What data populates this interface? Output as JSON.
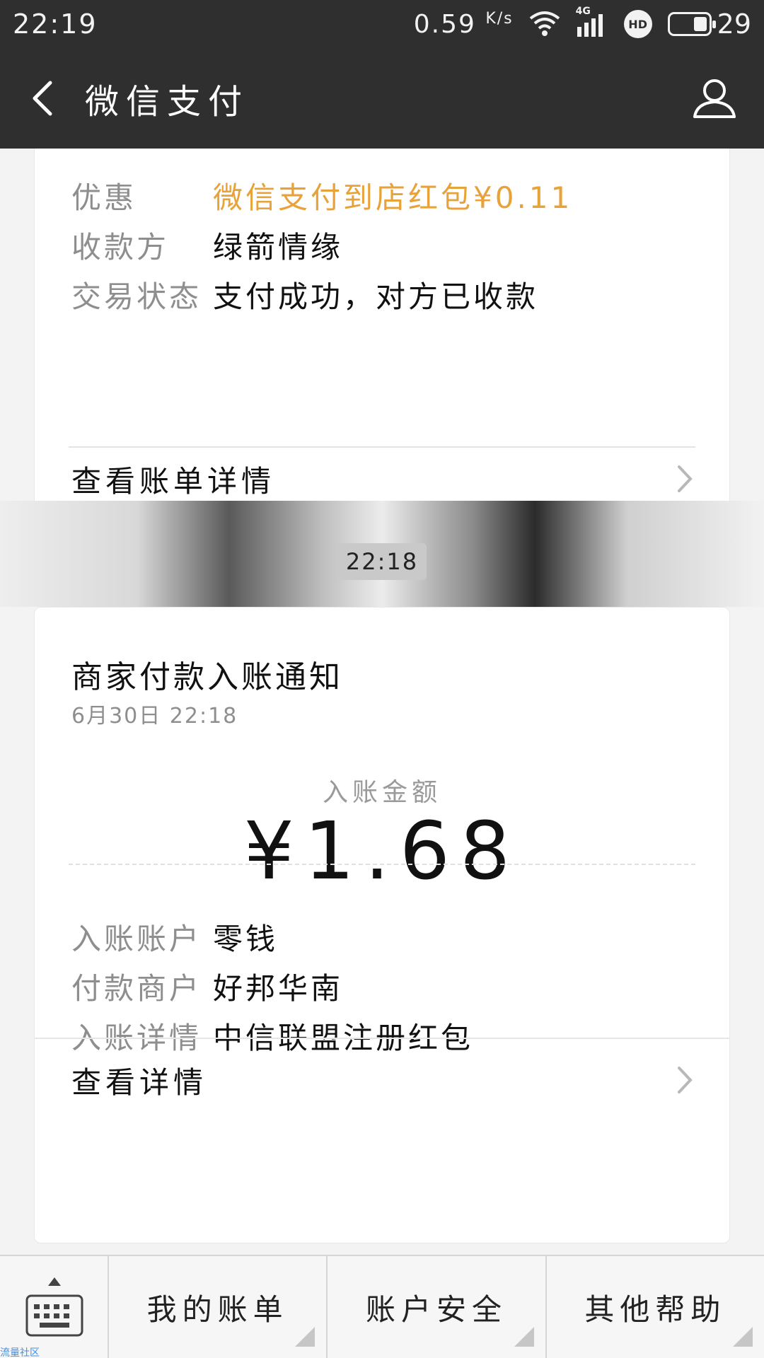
{
  "status_bar": {
    "time": "22:19",
    "speed": "0.59",
    "speed_unit": "K/s",
    "network": "4G",
    "battery": "29"
  },
  "app_bar": {
    "title": "微信支付"
  },
  "card1": {
    "rows": [
      {
        "label": "优惠",
        "value": "微信支付到店红包¥0.11"
      },
      {
        "label": "收款方",
        "value": "绿箭情缘"
      },
      {
        "label": "交易状态",
        "value": "支付成功，对方已收款"
      }
    ],
    "link_label": "查看账单详情"
  },
  "timestamp": "22:18",
  "card2": {
    "title": "商家付款入账通知",
    "date": "6月30日  22:18",
    "amount_label": "入账金额",
    "amount": "¥1.68",
    "rows": [
      {
        "label": "入账账户",
        "value": "零钱"
      },
      {
        "label": "付款商户",
        "value": "好邦华南"
      },
      {
        "label": "入账详情",
        "value": "中信联盟注册红包"
      }
    ],
    "link_label": "查看详情"
  },
  "bottom_menu": {
    "items": [
      "我的账单",
      "账户安全",
      "其他帮助"
    ]
  },
  "watermark": "流量社区",
  "colors": {
    "bar_bg": "#2f2f2f",
    "highlight": "#e8a23a"
  }
}
